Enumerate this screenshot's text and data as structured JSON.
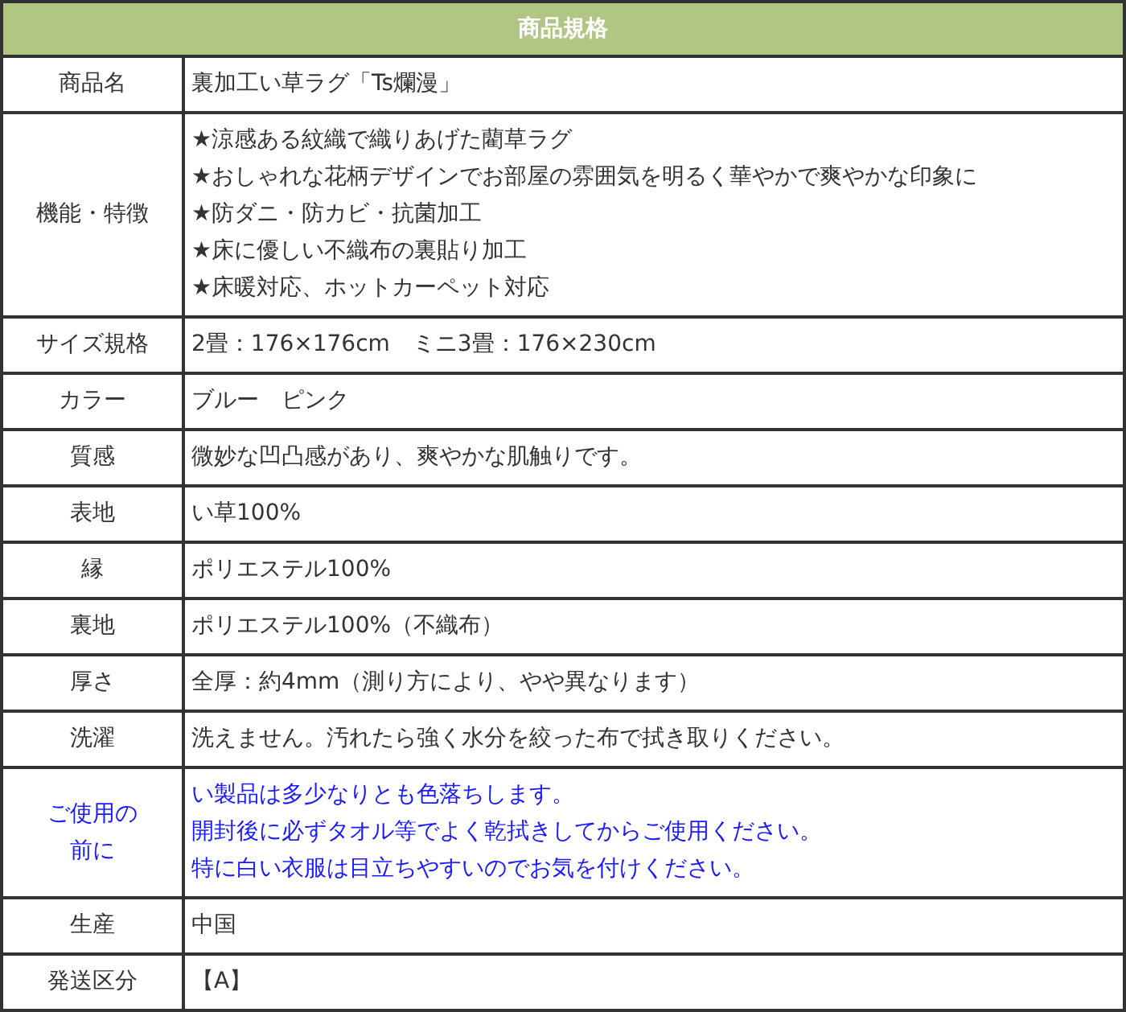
{
  "table": {
    "title": "商品規格",
    "rows": [
      {
        "kind": "normal",
        "label": [
          "商品名"
        ],
        "value": [
          "裏加工い草ラグ「Ts爛漫」"
        ]
      },
      {
        "kind": "normal",
        "label": [
          "機能・特徴"
        ],
        "value": [
          "★涼感ある紋織で織りあげた藺草ラグ",
          "★おしゃれな花柄デザインでお部屋の雰囲気を明るく華やかで爽やかな印象に",
          "★防ダニ・防カビ・抗菌加工",
          "★床に優しい不織布の裏貼り加工",
          "★床暖対応、ホットカーペット対応"
        ]
      },
      {
        "kind": "normal",
        "label": [
          "サイズ規格"
        ],
        "value": [
          "2畳：176×176cm　ミニ3畳：176×230cm"
        ]
      },
      {
        "kind": "normal",
        "label": [
          "カラー"
        ],
        "value": [
          "ブルー　ピンク"
        ]
      },
      {
        "kind": "normal",
        "label": [
          "質感"
        ],
        "value": [
          "微妙な凹凸感があり、爽やかな肌触りです。"
        ]
      },
      {
        "kind": "normal",
        "label": [
          "表地"
        ],
        "value": [
          "い草100%"
        ]
      },
      {
        "kind": "normal",
        "label": [
          "縁"
        ],
        "value": [
          "ポリエステル100%"
        ]
      },
      {
        "kind": "normal",
        "label": [
          "裏地"
        ],
        "value": [
          "ポリエステル100%（不織布）"
        ]
      },
      {
        "kind": "normal",
        "label": [
          "厚さ"
        ],
        "value": [
          "全厚：約4mm（測り方により、やや異なります）"
        ]
      },
      {
        "kind": "normal",
        "label": [
          "洗濯"
        ],
        "value": [
          "洗えません。汚れたら強く水分を絞った布で拭き取りください。"
        ]
      },
      {
        "kind": "warning",
        "label": [
          "ご使用の",
          "前に"
        ],
        "value": [
          "い製品は多少なりとも色落ちします。",
          "開封後に必ずタオル等でよく乾拭きしてからご使用ください。",
          "特に白い衣服は目立ちやすいのでお気を付けください。"
        ]
      },
      {
        "kind": "normal",
        "label": [
          "生産"
        ],
        "value": [
          "中国"
        ]
      },
      {
        "kind": "normal",
        "label": [
          "発送区分"
        ],
        "value": [
          "【A】"
        ]
      }
    ]
  }
}
